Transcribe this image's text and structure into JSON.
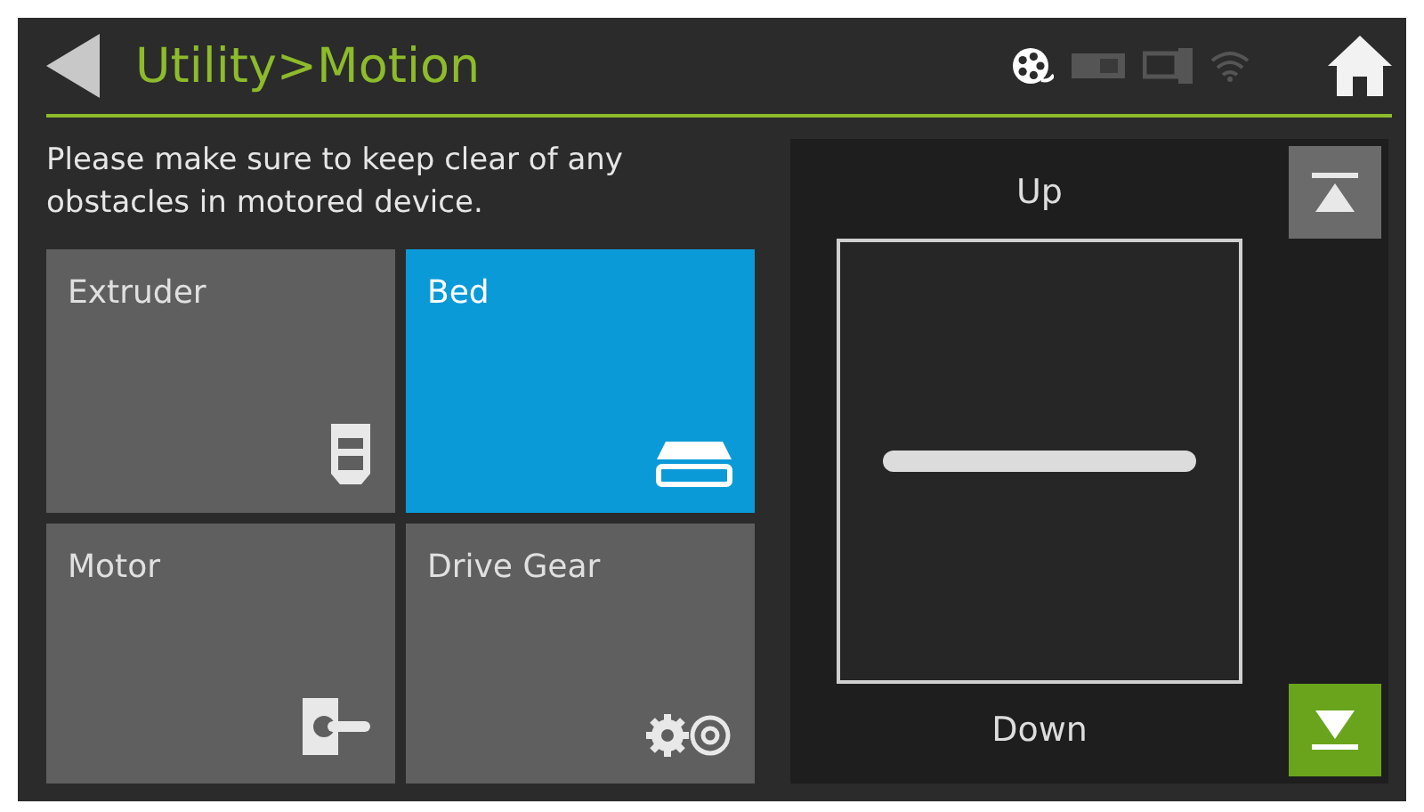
{
  "header": {
    "title": "Utility>Motion",
    "status_icons": [
      {
        "kind": "reel",
        "on": true
      },
      {
        "kind": "card",
        "on": false
      },
      {
        "kind": "monitor",
        "on": false
      },
      {
        "kind": "wifi",
        "on": false
      }
    ]
  },
  "notice": "Please make sure to keep clear of any obstacles in motored device.",
  "tiles": [
    {
      "label": "Extruder",
      "kind": "extruder",
      "selected": false
    },
    {
      "label": "Bed",
      "kind": "bed",
      "selected": true
    },
    {
      "label": "Motor",
      "kind": "motor",
      "selected": false
    },
    {
      "label": "Drive Gear",
      "kind": "gear",
      "selected": false
    }
  ],
  "jog": {
    "up_label": "Up",
    "down_label": "Down",
    "level": 0.5,
    "buttons": [
      {
        "kind": "up",
        "active": false
      },
      {
        "kind": "down",
        "active": true
      }
    ]
  }
}
